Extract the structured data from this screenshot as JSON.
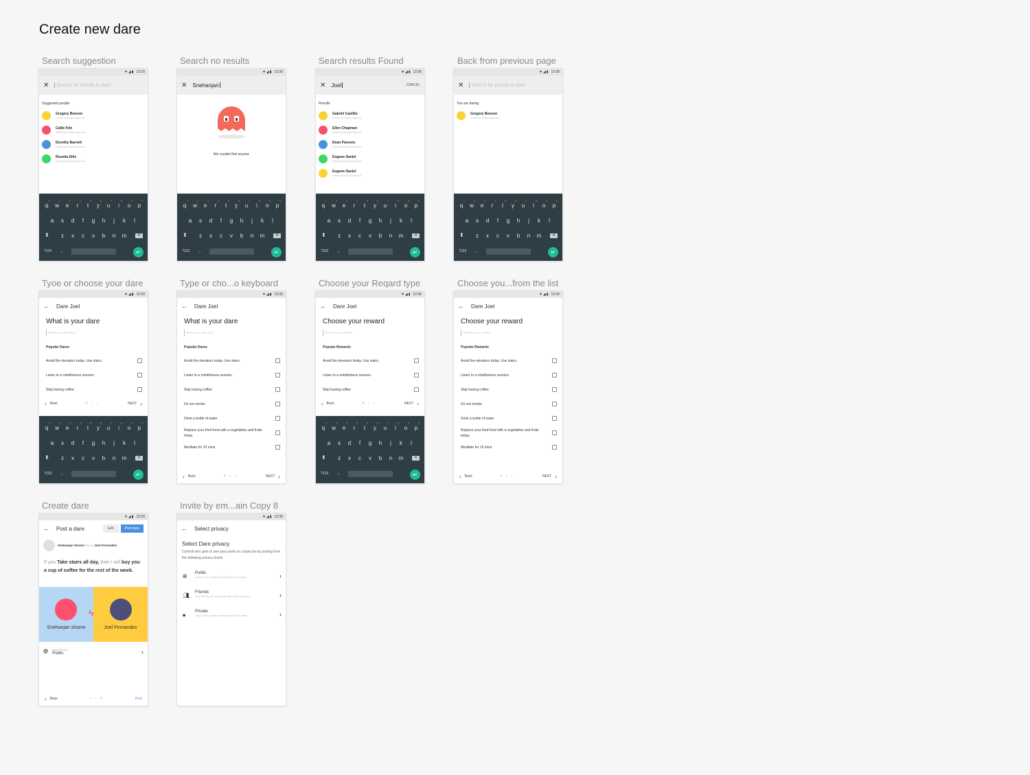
{
  "page_title": "Create new dare",
  "status_time": "12:30",
  "labels": [
    "Search suggestion",
    "Search no results",
    "Search results Found",
    "Back from previous page",
    "Tyoe or choose your dare",
    "Type or cho...o keyboard",
    "Choose your Reqard type",
    "Choose you...from the list",
    "Create dare",
    "Invite by em...ain Copy 8"
  ],
  "keyboard": {
    "row1": [
      "q",
      "w",
      "e",
      "r",
      "t",
      "y",
      "u",
      "i",
      "o",
      "p"
    ],
    "nums": [
      "1",
      "2",
      "3",
      "4",
      "5",
      "6",
      "7",
      "8",
      "9",
      "0"
    ],
    "row2": [
      "a",
      "s",
      "d",
      "f",
      "g",
      "h",
      "j",
      "k",
      "l"
    ],
    "row3": [
      "z",
      "x",
      "c",
      "v",
      "b",
      "n",
      "m"
    ],
    "sym": "?123",
    "comma": ","
  },
  "s1": {
    "placeholder": "Search for friends to dare",
    "section": "Suggested people",
    "people": [
      {
        "name": "Gregory Benson",
        "email": "mable.lynch@zoojoo.be",
        "color": "#fbd234"
      },
      {
        "name": "Callie Kim",
        "email": "mable.lynch@zoojoo.be",
        "color": "#f5506e"
      },
      {
        "name": "Dorothy Barnett",
        "email": "mable.lynch@zoojoo.be",
        "color": "#4a90e2"
      },
      {
        "name": "Rosetta Ellis",
        "email": "mable.lynch@zoojoo.be",
        "color": "#3ed56a"
      }
    ]
  },
  "s2": {
    "value": "Snehanjan",
    "empty_text": "We couldnt find anyone"
  },
  "s3": {
    "value": "Joel",
    "cancel": "CANCEL",
    "section": "Results",
    "people": [
      {
        "name": "Gabriel Castillo",
        "email": "mable.lynch@zoojoo.be",
        "color": "#fbd234"
      },
      {
        "name": "Ellen Chapman",
        "email": "mable.lynch@zoojoo.be",
        "color": "#f5506e"
      },
      {
        "name": "Dean Parsons",
        "email": "mable.lynch@zoojoo.be",
        "color": "#4a90e2"
      },
      {
        "name": "Eugene Daniel",
        "email": "mable.lynch@zoojoo.be",
        "color": "#3ed56a"
      },
      {
        "name": "Eugene Daniel",
        "email": "mable.lynch@zoojoo.be",
        "color": "#fbd234"
      }
    ]
  },
  "s4": {
    "placeholder": "Search for people to dare",
    "section": "You are daring",
    "people": [
      {
        "name": "Gregory Benson",
        "email": "mable.lynch@zoojoo.be",
        "color": "#fbd234"
      }
    ]
  },
  "dare": {
    "header": "Dare Joel",
    "question": "What is your dare",
    "placeholder": "Write your own dare",
    "popular": "Popular Dares",
    "options_short": [
      "Avoid the elevators today. Use stairs.",
      "Listen to a mindfulness session.",
      "Skip having coffee"
    ],
    "options_long": [
      "Avoid the elevators today. Use stairs.",
      "Listen to a mindfulness session.",
      "Skip having coffee",
      "Do not smoke",
      "Drink a bottle of water",
      "Replace your fried food with a vegetables and fruits today.",
      "Meditate for 10 mins"
    ]
  },
  "reward": {
    "header": "Dare Joel",
    "question": "Choose your reward",
    "placeholder": "Choose your reward",
    "popular": "Popular Rewards"
  },
  "nav": {
    "back": "Back",
    "next": "NEXT",
    "dots": "• ◦ ◦",
    "dots3": "◦ ◦ •",
    "post": "Post"
  },
  "post": {
    "header": "Post a dare",
    "edit": "Edit",
    "post_btn": "Post dare",
    "from": "Snehanjan Shome",
    "verb": "dared",
    "to": "Joel Fernandes",
    "if": "If you",
    "action": "Take stairs all day,",
    "then": "then i will",
    "reward_a": "buy",
    "reward_b": "you a cup of coffee for the rest of the week.",
    "left_name": "Snehanjan shome",
    "right_name": "Joel Fernandes",
    "privacy_label": "Post Privacy",
    "privacy_value": "Public"
  },
  "privacy": {
    "header": "Select privacy",
    "title": "Select Dare privacy",
    "desc": "Controll who gets to see your posts on zoojoo.be by picking from the following privacy levels",
    "items": [
      {
        "name": "Public",
        "desc": "Anyone on zoojoo.be within your company"
      },
      {
        "name": "Friends",
        "desc": "Your friends on zoojoo.be within the company"
      },
      {
        "name": "Private",
        "desc": "Only to the people participating in this dare"
      }
    ]
  },
  "icons": {
    "close": "close-icon",
    "back": "arrow-back-icon",
    "chev_l": "chevron-left-icon",
    "chev_r": "chevron-right-icon",
    "globe": "globe-icon",
    "people": "people-icon",
    "lock": "lock-icon",
    "ghost": "ghost-icon",
    "bolt": "bolt-icon"
  },
  "colors": {
    "accent": "#4a90e2",
    "keyboard": "#2e3e44",
    "enter": "#1fbc9c",
    "ghost": "#f36a5c"
  }
}
